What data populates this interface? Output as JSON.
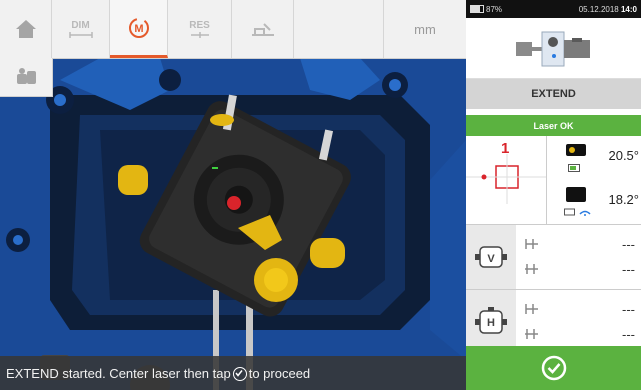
{
  "toolbar": {
    "dim_label": "DIM",
    "meas_label": "M",
    "res_label": "RES",
    "unit_label": "mm"
  },
  "status_bar": {
    "text_before": "EXTEND started. Center laser then tap",
    "text_after": "to proceed"
  },
  "system": {
    "battery": "87%",
    "datetime": "05.12.2018",
    "time": "14:0"
  },
  "panel": {
    "mode_label": "EXTEND",
    "laser_status": "Laser OK",
    "sensor_number": "1",
    "angle_top": "20.5°",
    "angle_bottom": "18.2°",
    "vertical_plane_letter": "V",
    "horizontal_plane_letter": "H",
    "v_offset": "---",
    "v_angle": "---",
    "h_offset": "---",
    "h_angle": "---"
  },
  "colors": {
    "accent": "#e55a2b",
    "status_green": "#5bb240",
    "sensor_red": "#d9242b"
  }
}
